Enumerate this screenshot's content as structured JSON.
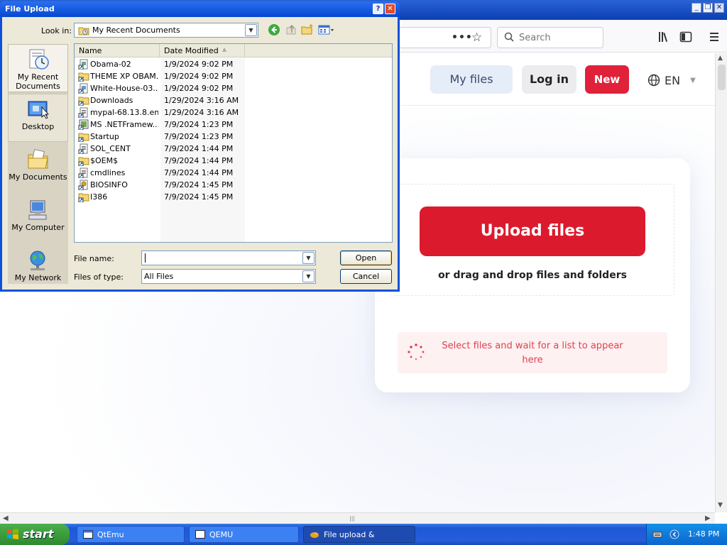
{
  "window_controls": {
    "minimize": "_",
    "restore": "❐",
    "close": "✕"
  },
  "browser": {
    "search_placeholder": "Search",
    "url_actions": "•••",
    "bookmark_star": "☆"
  },
  "site": {
    "my_files_label": "My files",
    "login_label": "Log in",
    "new_label": "New",
    "language": "EN",
    "upload_button": "Upload files",
    "drag_text": "or drag and drop files and folders",
    "status_text": "Select files and wait for a list to appear here",
    "accent_color": "#dc1a2e"
  },
  "dialog": {
    "title": "File Upload",
    "help": "?",
    "close": "✕",
    "look_in_label": "Look in:",
    "look_in_value": "My Recent Documents",
    "places": [
      {
        "label": "My Recent Documents",
        "icon": "recent-documents-icon"
      },
      {
        "label": "Desktop",
        "icon": "desktop-icon"
      },
      {
        "label": "My Documents",
        "icon": "my-documents-icon"
      },
      {
        "label": "My Computer",
        "icon": "my-computer-icon"
      },
      {
        "label": "My Network",
        "icon": "my-network-icon"
      }
    ],
    "columns": {
      "name": "Name",
      "date": "Date Modified"
    },
    "files": [
      {
        "name": "Obama-02",
        "date": "1/9/2024 9:02 PM",
        "icon": "shortcut-file-icon"
      },
      {
        "name": "THEME XP OBAM...",
        "date": "1/9/2024 9:02 PM",
        "icon": "shortcut-folder-icon"
      },
      {
        "name": "White-House-03...",
        "date": "1/9/2024 9:02 PM",
        "icon": "shortcut-file-icon"
      },
      {
        "name": "Downloads",
        "date": "1/29/2024 3:16 AM",
        "icon": "shortcut-folder-icon"
      },
      {
        "name": "mypal-68.13.8.en...",
        "date": "1/29/2024 3:16 AM",
        "icon": "shortcut-file-icon"
      },
      {
        "name": "MS .NETFramew...",
        "date": "7/9/2024 1:23 PM",
        "icon": "shortcut-app-icon"
      },
      {
        "name": "Startup",
        "date": "7/9/2024 1:23 PM",
        "icon": "shortcut-folder-icon"
      },
      {
        "name": "SOL_CENT",
        "date": "7/9/2024 1:44 PM",
        "icon": "shortcut-file-icon"
      },
      {
        "name": "$OEM$",
        "date": "7/9/2024 1:44 PM",
        "icon": "shortcut-folder-icon"
      },
      {
        "name": "cmdlines",
        "date": "7/9/2024 1:44 PM",
        "icon": "shortcut-file-icon"
      },
      {
        "name": "BIOSINFO",
        "date": "7/9/2024 1:45 PM",
        "icon": "shortcut-settings-icon"
      },
      {
        "name": "I386",
        "date": "7/9/2024 1:45 PM",
        "icon": "shortcut-folder-icon"
      }
    ],
    "file_name_label": "File name:",
    "file_name_value": "",
    "files_of_type_label": "Files of type:",
    "files_of_type_value": "All Files",
    "open_label": "Open",
    "cancel_label": "Cancel"
  },
  "taskbar": {
    "start_label": "start",
    "tasks": [
      {
        "label": "QtEmu",
        "active": false
      },
      {
        "label": "QEMU",
        "active": false
      },
      {
        "label": "File upload & sharing....",
        "active": true
      }
    ],
    "clock": "1:48 PM"
  }
}
